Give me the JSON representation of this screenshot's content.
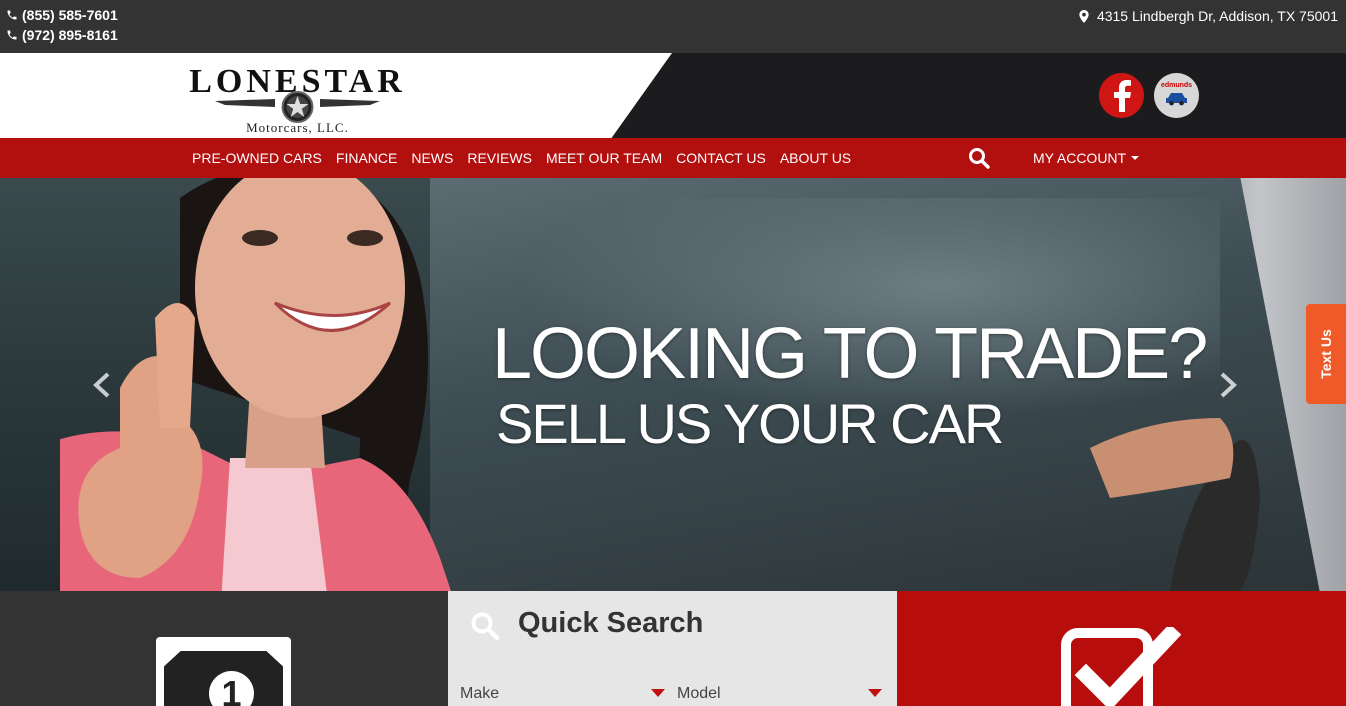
{
  "topbar": {
    "phone1": "(855) 585-7601",
    "phone2": "(972) 895-8161",
    "address": "4315 Lindbergh Dr, Addison, TX 75001"
  },
  "logo": {
    "title": "LONESTAR",
    "subtitle": "Motorcars, LLC."
  },
  "social": {
    "facebook_icon": "facebook-icon",
    "edmunds_label": "edmunds"
  },
  "nav": {
    "items": [
      {
        "label": "PRE-OWNED CARS"
      },
      {
        "label": "FINANCE"
      },
      {
        "label": "NEWS"
      },
      {
        "label": "REVIEWS"
      },
      {
        "label": "MEET OUR TEAM"
      },
      {
        "label": "CONTACT US"
      },
      {
        "label": "ABOUT US"
      }
    ],
    "account_label": "MY ACCOUNT"
  },
  "hero": {
    "title": "LOOKING TO TRADE?",
    "subtitle": "SELL US YOUR CAR",
    "text_us": "Text Us"
  },
  "quick_search": {
    "title": "Quick Search",
    "make_label": "Make",
    "model_label": "Model"
  },
  "colors": {
    "brand_red": "#b20f0f",
    "topbar_bg": "#333333",
    "text_us_orange": "#f05a28"
  }
}
